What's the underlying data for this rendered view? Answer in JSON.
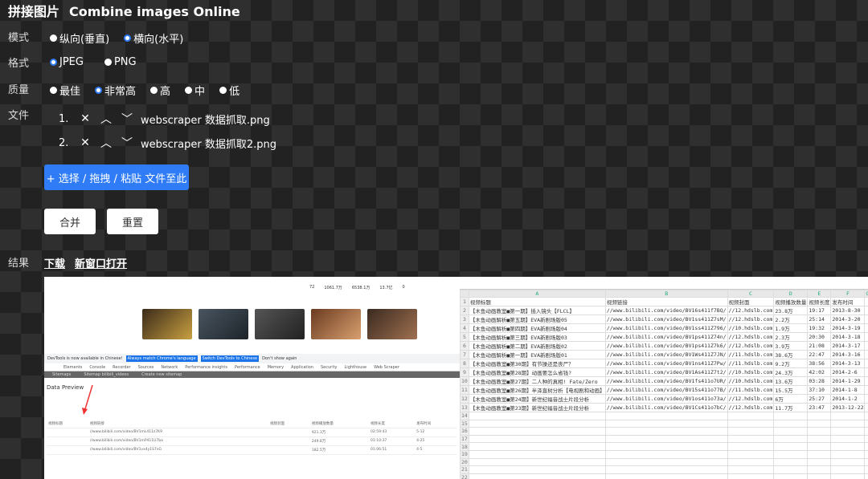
{
  "title": {
    "cn": "拼接图片",
    "en": "Combine images Online"
  },
  "labels": {
    "mode": "模式",
    "format": "格式",
    "quality": "质量",
    "files": "文件",
    "result": "结果"
  },
  "mode_options": [
    {
      "label": "纵向(垂直)",
      "selected": false
    },
    {
      "label": "横向(水平)",
      "selected": true
    }
  ],
  "format_options": [
    {
      "label": "JPEG",
      "selected": true
    },
    {
      "label": "PNG",
      "selected": false
    }
  ],
  "quality_options": [
    {
      "label": "最佳",
      "selected": false
    },
    {
      "label": "非常高",
      "selected": true
    },
    {
      "label": "高",
      "selected": false
    },
    {
      "label": "中",
      "selected": false
    },
    {
      "label": "低",
      "selected": false
    }
  ],
  "files": [
    {
      "num": "1.",
      "name": "webscraper 数据抓取.png"
    },
    {
      "num": "2.",
      "name": "webscraper 数据抓取2.png"
    }
  ],
  "file_icons": {
    "remove": "✕",
    "up": "︿",
    "down": "﹀"
  },
  "buttons": {
    "select": "+ 选择 / 拖拽 / 粘贴 文件至此",
    "merge": "合并",
    "reset": "重置"
  },
  "links": {
    "download": "下载",
    "open_new": "新窗口打开"
  },
  "preview": {
    "devtools_notice": "DevTools is now available in Chinese!",
    "match": "Always match Chrome's language",
    "switch": "Switch DevTools to Chinese",
    "dont_show": "Don't show again",
    "tabs": [
      "Elements",
      "Console",
      "Recorder",
      "Sources",
      "Network",
      "Performance insights",
      "Performance",
      "Memory",
      "Application",
      "Security",
      "Lighthouse",
      "Web Scraper"
    ],
    "subtabs": [
      "Sitemaps",
      "Sitemap bilibili_videos",
      "Create new sitemap"
    ],
    "data_preview": "Data Preview",
    "headers": [
      "视频标题",
      "视频链接",
      "视频封面",
      "视频播放数量",
      "视频长度",
      "发布时间"
    ],
    "rows": [
      [
        "//www.bilibili.com/video/BV1mL411z7K9",
        "921.3万",
        "02:59:43",
        "5-12"
      ],
      [
        "//www.bilibili.com/video/BV1mP411U7ba",
        "249.8万",
        "01:10:37",
        "4-25"
      ],
      [
        "//www.bilibili.com/video/BV1vx4y1S7xG",
        "182.5万",
        "01:06:51",
        "4-5"
      ]
    ],
    "stats": [
      "72",
      "1061.7万",
      "6538.1万",
      "13.7亿",
      "0"
    ]
  },
  "sheet": {
    "cols": [
      "A",
      "B",
      "C",
      "D",
      "E",
      "F",
      "G"
    ],
    "headers": [
      "视频标题",
      "视频链接",
      "视频封面",
      "视频播放数量",
      "视频长度",
      "发布时间"
    ],
    "rows": [
      [
        "【木鱼动画教室■第一期】插入镜头【FLCL】",
        "//www.bilibili.com/video/BV16s411f7BQ/",
        "//12.hdslb.com",
        "23.8万",
        "19:17",
        "2013-8-30"
      ],
      [
        "【木鱼动画解析■第五期】EVA新剧场版05",
        "//www.bilibili.com/video/BV1ss411Z7sM/",
        "//12.hdslb.com",
        "2.2万",
        "25:14",
        "2014-3-20"
      ],
      [
        "【木鱼动画解析■第四期】EVA新剧场版04",
        "//www.bilibili.com/video/BV1ss411Z796/",
        "//10.hdslb.com",
        "1.9万",
        "19:32",
        "2014-3-19"
      ],
      [
        "【木鱼动画解析■第三期】EVA新剧场版03",
        "//www.bilibili.com/video/BV1ps411Z74n/",
        "//12.hdslb.com",
        "2.3万",
        "20:30",
        "2014-3-18"
      ],
      [
        "【木鱼动画解析■第二期】EVA新剧场版02",
        "//www.bilibili.com/video/BV1ps411Z7k6/",
        "//12.hdslb.com",
        "3.9万",
        "21:08",
        "2014-3-17"
      ],
      [
        "【木鱼动画解析■第一期】EVA新剧场版01",
        "//www.bilibili.com/video/BV1Ws411Z7JN/",
        "//11.hdslb.com",
        "38.6万",
        "22:47",
        "2014-3-16"
      ],
      [
        "【木鱼动画教室■第30期】有节操还是丧尸？",
        "//www.bilibili.com/video/BV1ns411Z7Pw/",
        "//11.hdslb.com",
        "9.2万",
        "38:56",
        "2014-3-13"
      ],
      [
        "【木鱼动画教室■第28期】动画要怎么省钱?",
        "//www.bilibili.com/video/BV1As411Z7t2/",
        "//10.hdslb.com",
        "24.3万",
        "42:02",
        "2014-2-6"
      ],
      [
        "【木鱼动画教室■第27期】二人种的真相! Fate/Zero",
        "//www.bilibili.com/video/BV1fs411o7UR/",
        "//10.hdslb.com",
        "13.6万",
        "03:28",
        "2014-1-29"
      ],
      [
        "【木鱼动画教室■第26期】半泽直树分析【电视剧和动画】",
        "//www.bilibili.com/video/BV15s411o77B/",
        "//11.hdslb.com",
        "15.5万",
        "37:10",
        "2014-1-8"
      ],
      [
        "【木鱼动画教室■第24期】新世纪福音战士片段分析",
        "//www.bilibili.com/video/BV1os411o73a/",
        "//12.hdslb.com",
        "6万",
        "25:27",
        "2014-1-2"
      ],
      [
        "【木鱼动画教室■第23期】新世纪福音战士片段分析",
        "//www.bilibili.com/video/BV1Cs411o7bC/",
        "//12.hdslb.com",
        "11.7万",
        "23:47",
        "2013-12-22"
      ]
    ]
  },
  "colors": {
    "accent": "#2f7cf6"
  }
}
